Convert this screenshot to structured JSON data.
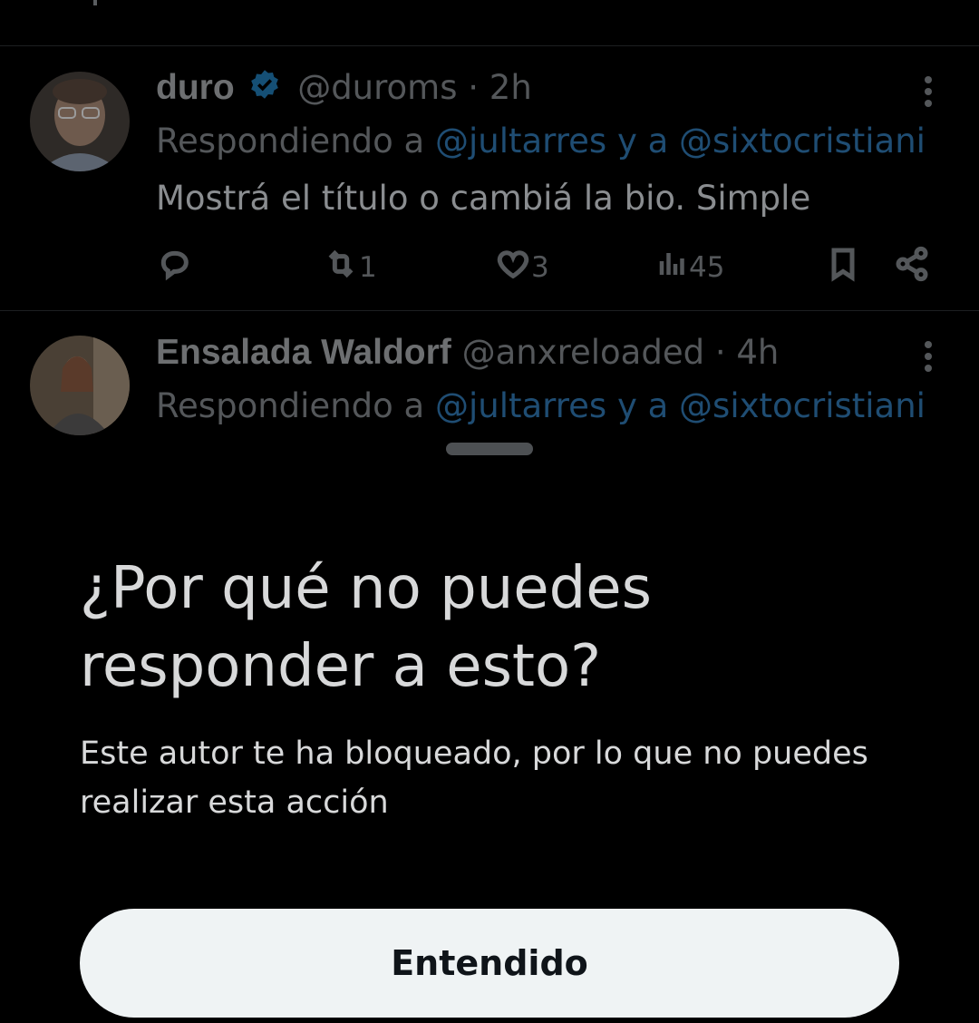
{
  "tweets": [
    {
      "name": "duro",
      "handle": "@duroms",
      "time": "· 2h",
      "reply_prefix": "Respondiendo a",
      "mention1": "@jultarres",
      "mention_join": "y a",
      "mention2": "@sixtocristiani",
      "text": "Mostrá el título o cambiá la bio. Simple",
      "retweets": "1",
      "likes": "3",
      "views": "45",
      "verified": true
    },
    {
      "name": "Ensalada Waldorf",
      "handle": "@anxreloaded",
      "time": "· 4h",
      "reply_prefix": "Respondiendo a",
      "mention1": "@jultarres",
      "mention_join": "y a",
      "mention2": "@sixtocristiani"
    }
  ],
  "sheet": {
    "title": "¿Por qué no puedes responder a esto?",
    "body": "Este autor te ha bloqueado, por lo que no puedes realizar esta acción",
    "button_label": "Entendido"
  },
  "colors": {
    "background": "#000000",
    "mention": "#1d9bf0",
    "verified": "#1d9bf0",
    "button_bg": "#eff3f4"
  },
  "icons": [
    "verified-badge-icon",
    "more-icon",
    "reply-icon",
    "retweet-icon",
    "like-icon",
    "views-icon",
    "bookmark-icon",
    "share-icon"
  ]
}
